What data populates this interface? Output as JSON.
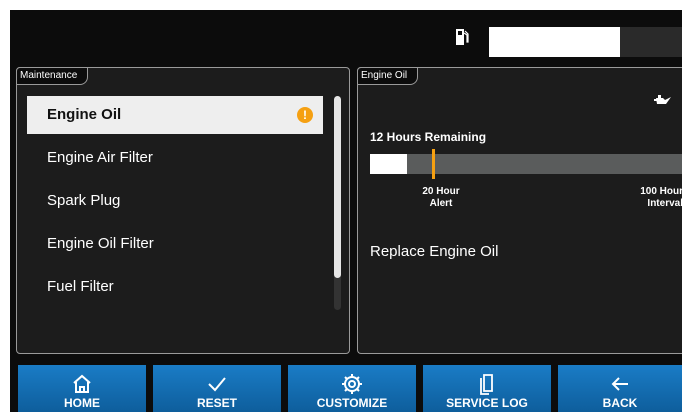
{
  "status": {
    "fuel_icon": "fuel-pump-icon",
    "fuel_level_fraction": 0.68
  },
  "maintenance": {
    "tab_label": "Maintenance",
    "items": [
      {
        "label": "Engine Oil",
        "selected": true,
        "alert": true
      },
      {
        "label": "Engine Air Filter"
      },
      {
        "label": "Spark Plug"
      },
      {
        "label": "Engine Oil Filter"
      },
      {
        "label": "Fuel Filter"
      }
    ],
    "alert_glyph": "!",
    "alert_color": "#f5a012",
    "scroll_fraction": 0.85
  },
  "detail": {
    "tab_label": "Engine Oil",
    "icon": "oil-can-icon",
    "hours_remaining": "12 Hours Remaining",
    "progress_fraction": 0.12,
    "alert_hour_fraction": 0.2,
    "alert_label_line1": "20 Hour",
    "alert_label_line2": "Alert",
    "interval_label_line1": "100 Hour",
    "interval_label_line2": "Interval",
    "message": "Replace Engine Oil"
  },
  "buttons": [
    {
      "label": "HOME",
      "icon": "home-icon"
    },
    {
      "label": "RESET",
      "icon": "checkmark-icon"
    },
    {
      "label": "CUSTOMIZE",
      "icon": "gear-icon"
    },
    {
      "label": "SERVICE LOG",
      "icon": "documents-icon"
    },
    {
      "label": "BACK",
      "icon": "arrow-left-icon"
    }
  ],
  "colors": {
    "button_blue": "#1a7cc6",
    "accent_orange": "#f5a012",
    "background": "#0c0c0c"
  }
}
